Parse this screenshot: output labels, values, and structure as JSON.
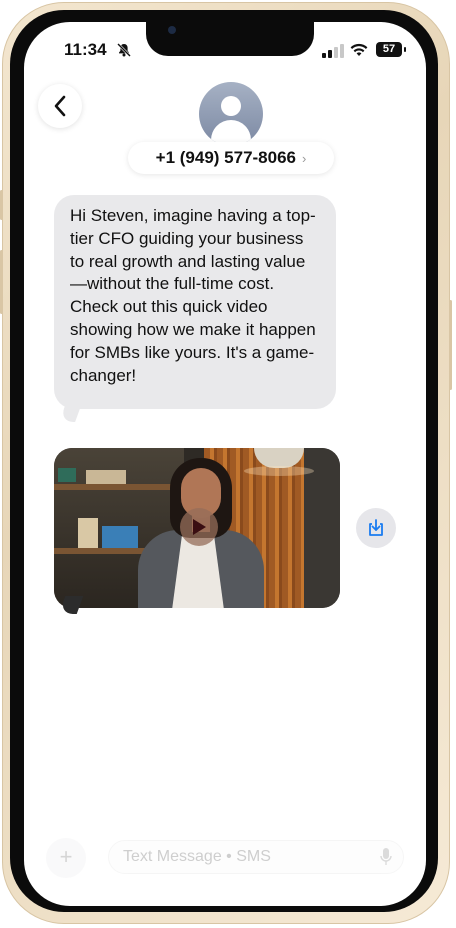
{
  "status_bar": {
    "time": "11:34",
    "battery": "57",
    "icons": [
      "bell-slash-icon",
      "cellular-signal-icon",
      "wifi-icon",
      "battery-icon"
    ]
  },
  "header": {
    "contact": "+1 (949) 577-8066",
    "chevron": "›",
    "icons": [
      "back-chevron-icon",
      "avatar-icon"
    ]
  },
  "message": {
    "paragraphs": [
      "Hi Steven, imagine having a top-tier CFO guiding your business to real growth and lasting value—without the full-time cost.",
      "Check out this quick video showing how we make it happen for SMBs like yours. It's a game-changer!"
    ]
  },
  "video": {
    "icons": [
      "play-icon",
      "save-download-icon"
    ]
  },
  "composer": {
    "placeholder": "Text Message • SMS",
    "plus": "+",
    "icons": [
      "plus-icon",
      "microphone-icon"
    ]
  },
  "colors": {
    "bubble": "#e9e9eb",
    "accent": "#1a7cf0",
    "frame": "#efe1c7"
  }
}
